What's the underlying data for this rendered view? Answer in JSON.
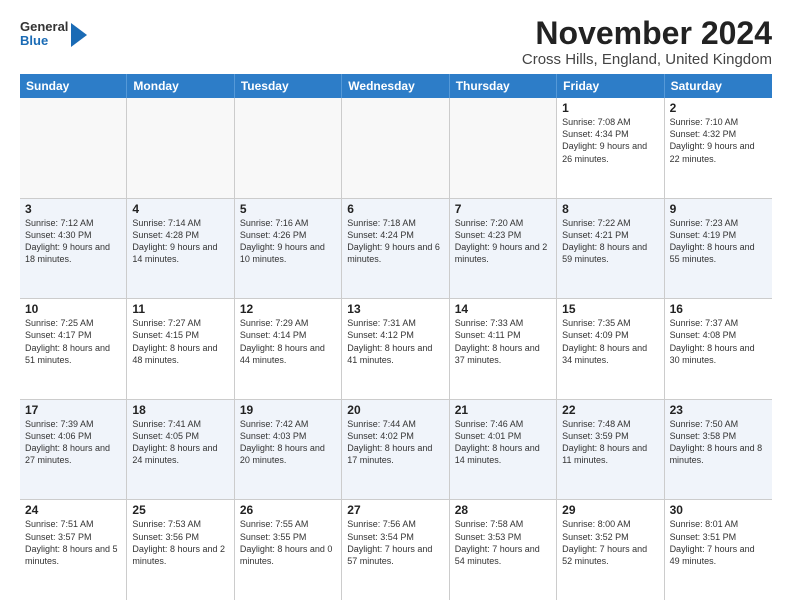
{
  "logo": {
    "general": "General",
    "blue": "Blue"
  },
  "title": "November 2024",
  "location": "Cross Hills, England, United Kingdom",
  "header_days": [
    "Sunday",
    "Monday",
    "Tuesday",
    "Wednesday",
    "Thursday",
    "Friday",
    "Saturday"
  ],
  "rows": [
    [
      {
        "day": "",
        "text": "",
        "empty": true
      },
      {
        "day": "",
        "text": "",
        "empty": true
      },
      {
        "day": "",
        "text": "",
        "empty": true
      },
      {
        "day": "",
        "text": "",
        "empty": true
      },
      {
        "day": "",
        "text": "",
        "empty": true
      },
      {
        "day": "1",
        "text": "Sunrise: 7:08 AM\nSunset: 4:34 PM\nDaylight: 9 hours and 26 minutes.",
        "empty": false
      },
      {
        "day": "2",
        "text": "Sunrise: 7:10 AM\nSunset: 4:32 PM\nDaylight: 9 hours and 22 minutes.",
        "empty": false
      }
    ],
    [
      {
        "day": "3",
        "text": "Sunrise: 7:12 AM\nSunset: 4:30 PM\nDaylight: 9 hours and 18 minutes.",
        "empty": false
      },
      {
        "day": "4",
        "text": "Sunrise: 7:14 AM\nSunset: 4:28 PM\nDaylight: 9 hours and 14 minutes.",
        "empty": false
      },
      {
        "day": "5",
        "text": "Sunrise: 7:16 AM\nSunset: 4:26 PM\nDaylight: 9 hours and 10 minutes.",
        "empty": false
      },
      {
        "day": "6",
        "text": "Sunrise: 7:18 AM\nSunset: 4:24 PM\nDaylight: 9 hours and 6 minutes.",
        "empty": false
      },
      {
        "day": "7",
        "text": "Sunrise: 7:20 AM\nSunset: 4:23 PM\nDaylight: 9 hours and 2 minutes.",
        "empty": false
      },
      {
        "day": "8",
        "text": "Sunrise: 7:22 AM\nSunset: 4:21 PM\nDaylight: 8 hours and 59 minutes.",
        "empty": false
      },
      {
        "day": "9",
        "text": "Sunrise: 7:23 AM\nSunset: 4:19 PM\nDaylight: 8 hours and 55 minutes.",
        "empty": false
      }
    ],
    [
      {
        "day": "10",
        "text": "Sunrise: 7:25 AM\nSunset: 4:17 PM\nDaylight: 8 hours and 51 minutes.",
        "empty": false
      },
      {
        "day": "11",
        "text": "Sunrise: 7:27 AM\nSunset: 4:15 PM\nDaylight: 8 hours and 48 minutes.",
        "empty": false
      },
      {
        "day": "12",
        "text": "Sunrise: 7:29 AM\nSunset: 4:14 PM\nDaylight: 8 hours and 44 minutes.",
        "empty": false
      },
      {
        "day": "13",
        "text": "Sunrise: 7:31 AM\nSunset: 4:12 PM\nDaylight: 8 hours and 41 minutes.",
        "empty": false
      },
      {
        "day": "14",
        "text": "Sunrise: 7:33 AM\nSunset: 4:11 PM\nDaylight: 8 hours and 37 minutes.",
        "empty": false
      },
      {
        "day": "15",
        "text": "Sunrise: 7:35 AM\nSunset: 4:09 PM\nDaylight: 8 hours and 34 minutes.",
        "empty": false
      },
      {
        "day": "16",
        "text": "Sunrise: 7:37 AM\nSunset: 4:08 PM\nDaylight: 8 hours and 30 minutes.",
        "empty": false
      }
    ],
    [
      {
        "day": "17",
        "text": "Sunrise: 7:39 AM\nSunset: 4:06 PM\nDaylight: 8 hours and 27 minutes.",
        "empty": false
      },
      {
        "day": "18",
        "text": "Sunrise: 7:41 AM\nSunset: 4:05 PM\nDaylight: 8 hours and 24 minutes.",
        "empty": false
      },
      {
        "day": "19",
        "text": "Sunrise: 7:42 AM\nSunset: 4:03 PM\nDaylight: 8 hours and 20 minutes.",
        "empty": false
      },
      {
        "day": "20",
        "text": "Sunrise: 7:44 AM\nSunset: 4:02 PM\nDaylight: 8 hours and 17 minutes.",
        "empty": false
      },
      {
        "day": "21",
        "text": "Sunrise: 7:46 AM\nSunset: 4:01 PM\nDaylight: 8 hours and 14 minutes.",
        "empty": false
      },
      {
        "day": "22",
        "text": "Sunrise: 7:48 AM\nSunset: 3:59 PM\nDaylight: 8 hours and 11 minutes.",
        "empty": false
      },
      {
        "day": "23",
        "text": "Sunrise: 7:50 AM\nSunset: 3:58 PM\nDaylight: 8 hours and 8 minutes.",
        "empty": false
      }
    ],
    [
      {
        "day": "24",
        "text": "Sunrise: 7:51 AM\nSunset: 3:57 PM\nDaylight: 8 hours and 5 minutes.",
        "empty": false
      },
      {
        "day": "25",
        "text": "Sunrise: 7:53 AM\nSunset: 3:56 PM\nDaylight: 8 hours and 2 minutes.",
        "empty": false
      },
      {
        "day": "26",
        "text": "Sunrise: 7:55 AM\nSunset: 3:55 PM\nDaylight: 8 hours and 0 minutes.",
        "empty": false
      },
      {
        "day": "27",
        "text": "Sunrise: 7:56 AM\nSunset: 3:54 PM\nDaylight: 7 hours and 57 minutes.",
        "empty": false
      },
      {
        "day": "28",
        "text": "Sunrise: 7:58 AM\nSunset: 3:53 PM\nDaylight: 7 hours and 54 minutes.",
        "empty": false
      },
      {
        "day": "29",
        "text": "Sunrise: 8:00 AM\nSunset: 3:52 PM\nDaylight: 7 hours and 52 minutes.",
        "empty": false
      },
      {
        "day": "30",
        "text": "Sunrise: 8:01 AM\nSunset: 3:51 PM\nDaylight: 7 hours and 49 minutes.",
        "empty": false
      }
    ]
  ]
}
